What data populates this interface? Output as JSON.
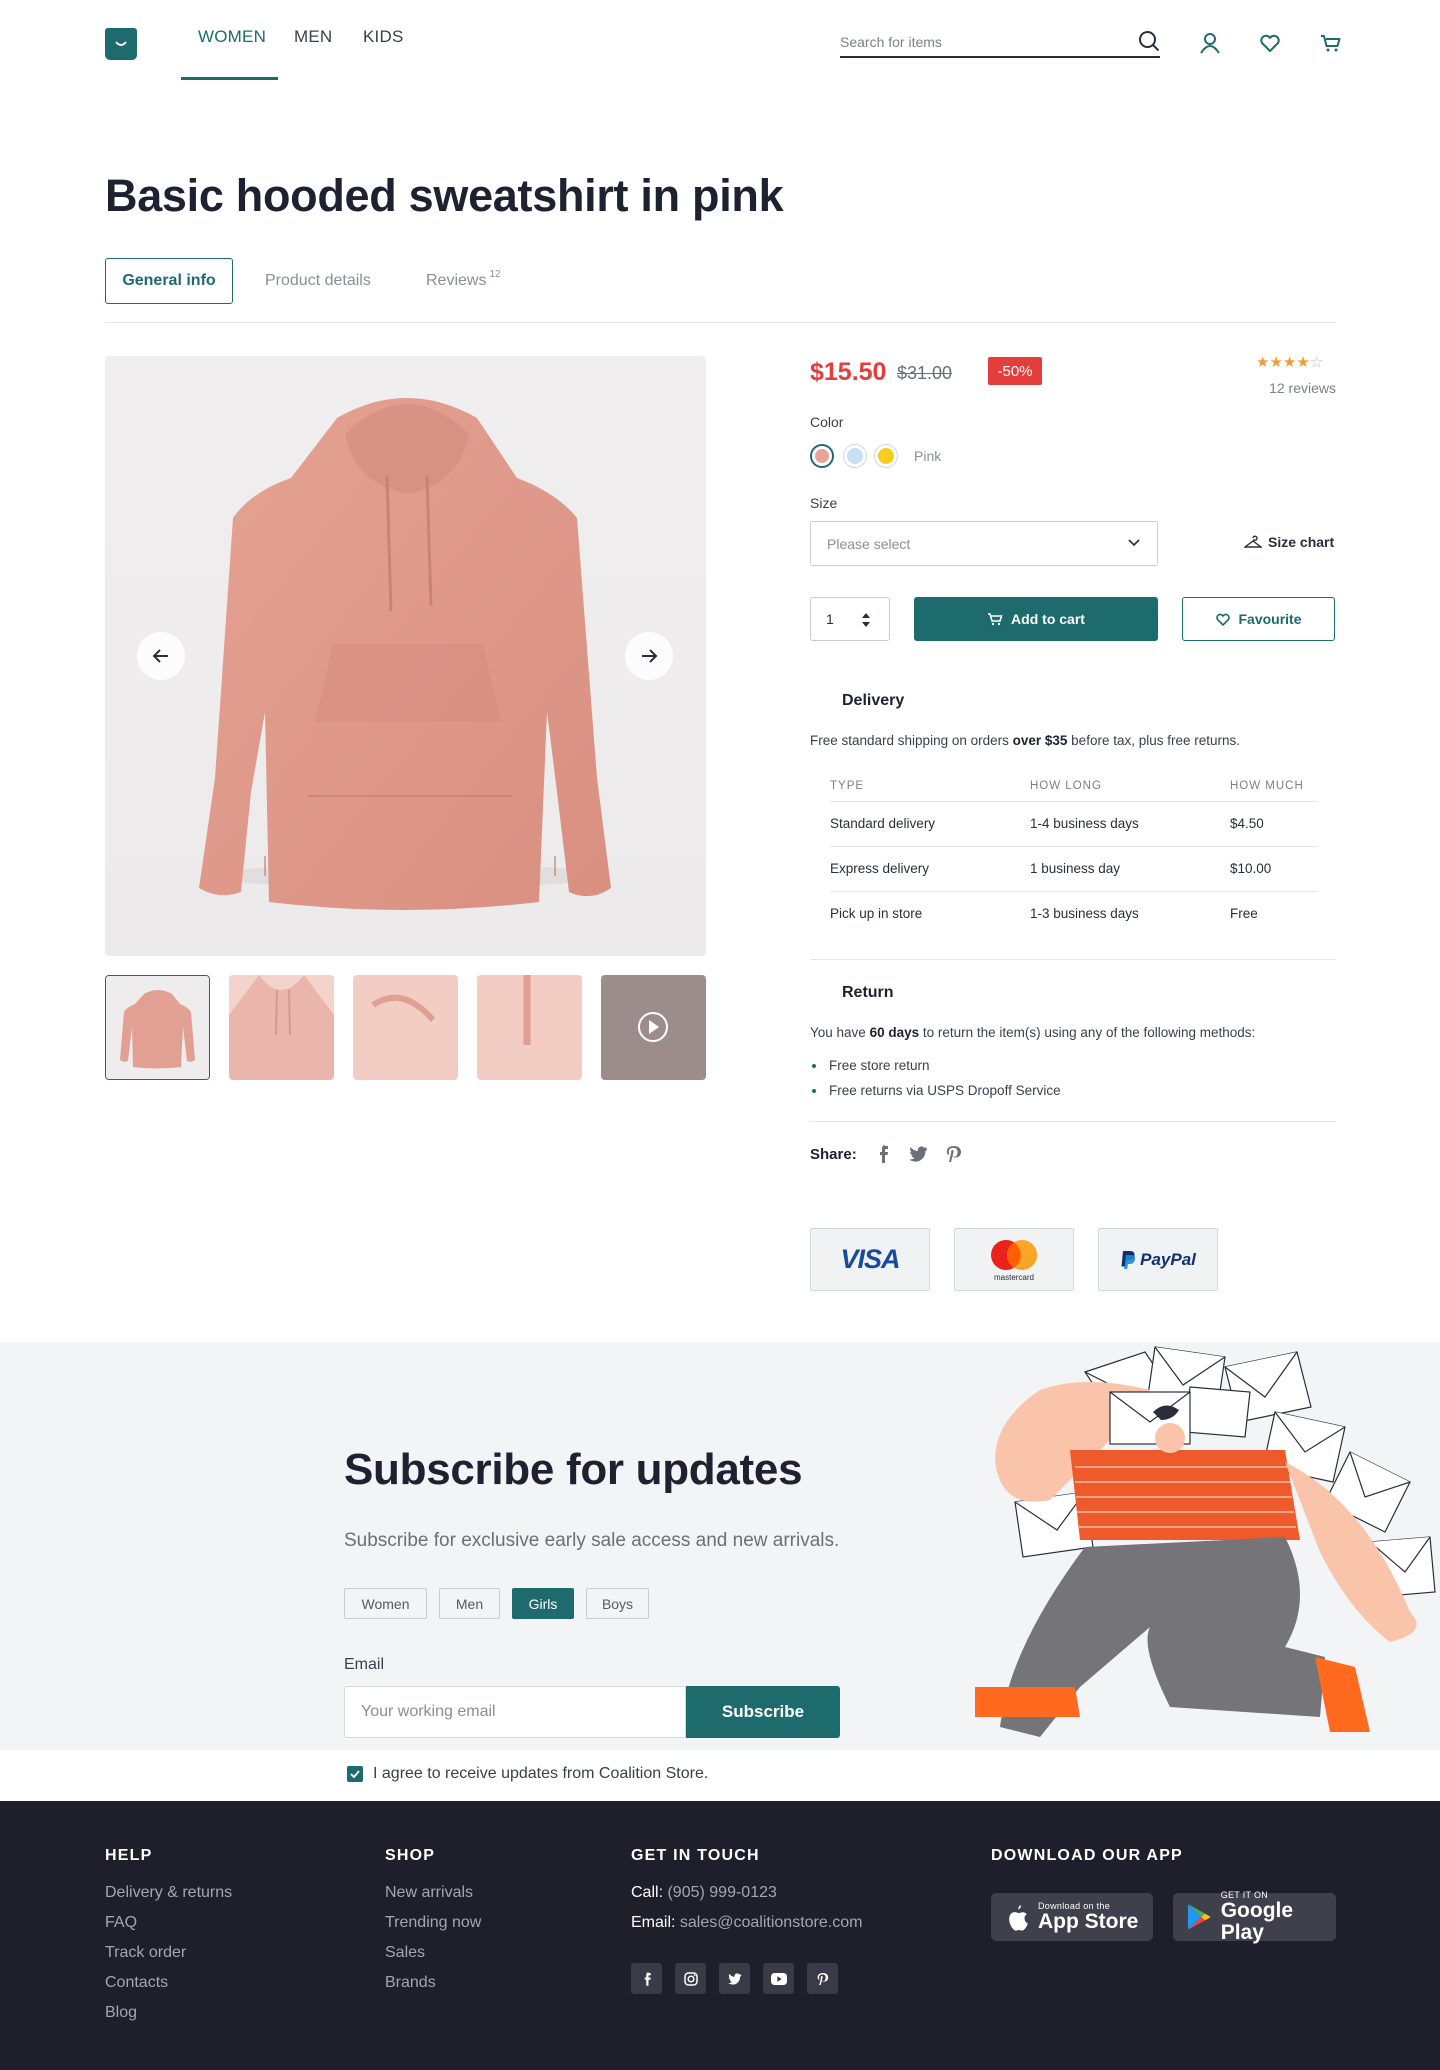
{
  "header": {
    "nav": [
      "WOMEN",
      "MEN",
      "KIDS"
    ],
    "search_placeholder": "Search for items"
  },
  "product": {
    "title": "Basic hooded sweatshirt in pink",
    "tabs": [
      {
        "label": "General info"
      },
      {
        "label": "Product details"
      },
      {
        "label": "Reviews",
        "badge": "12"
      }
    ],
    "price": "$15.50",
    "old_price": "$31.00",
    "discount": "-50%",
    "rating": 4,
    "rating_max": 5,
    "reviews_label": "12 reviews",
    "color_label": "Color",
    "colors": [
      {
        "name": "Pink",
        "hex": "#e7a59a"
      },
      {
        "name": "Light blue",
        "hex": "#c7e1f3"
      },
      {
        "name": "Yellow",
        "hex": "#f5cd1e"
      }
    ],
    "selected_color": "Pink",
    "size_label": "Size",
    "size_placeholder": "Please select",
    "size_chart": "Size chart",
    "quantity": "1",
    "add_to_cart": "Add to cart",
    "favourite": "Favourite"
  },
  "delivery": {
    "title": "Delivery",
    "text_before": "Free standard shipping on orders ",
    "text_bold": "over $35",
    "text_after": " before tax, plus free returns.",
    "columns": [
      "TYPE",
      "HOW LONG",
      "HOW MUCH"
    ],
    "rows": [
      [
        "Standard delivery",
        "1-4 business days",
        "$4.50"
      ],
      [
        "Express delivery",
        "1 business day",
        "$10.00"
      ],
      [
        "Pick up in store",
        "1-3 business days",
        "Free"
      ]
    ]
  },
  "return": {
    "title": "Return",
    "text_before": "You have ",
    "text_bold": "60 days",
    "text_after": " to return the item(s) using any of the following methods:",
    "methods": [
      "Free store return",
      "Free returns via USPS Dropoff Service"
    ]
  },
  "share_label": "Share:",
  "payments": [
    "VISA",
    "mastercard",
    "PayPal"
  ],
  "subscribe": {
    "title": "Subscribe for updates",
    "text": "Subscribe for exclusive early sale access and new arrivals.",
    "chips": [
      "Women",
      "Men",
      "Girls",
      "Boys"
    ],
    "selected_chip": "Girls",
    "email_label": "Email",
    "email_placeholder": "Your working email",
    "button": "Subscribe",
    "agree": "I agree to receive updates from Coalition Store."
  },
  "footer": {
    "help": {
      "title": "HELP",
      "links": [
        "Delivery & returns",
        "FAQ",
        "Track order",
        "Contacts",
        "Blog"
      ]
    },
    "shop": {
      "title": "SHOP",
      "links": [
        "New arrivals",
        "Trending now",
        "Sales",
        "Brands"
      ]
    },
    "contact": {
      "title": "GET IN TOUCH",
      "call_label": "Call:",
      "call": "(905) 999-0123",
      "email_label": "Email:",
      "email": "sales@coalitionstore.com"
    },
    "app": {
      "title": "DOWNLOAD OUR APP",
      "appstore_small": "Download on the",
      "appstore_big": "App Store",
      "play_small": "GET IT ON",
      "play_big": "Google Play"
    }
  },
  "colors": {
    "accent": "#1d6b6c",
    "sale": "#e53c3c",
    "footer_bg": "#1e1f2b"
  }
}
